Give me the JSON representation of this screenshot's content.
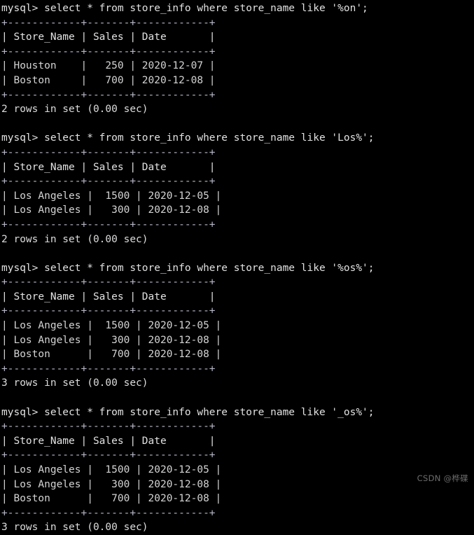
{
  "terminal": {
    "prompt": "mysql> ",
    "colors": {
      "background": "#000000",
      "text": "#d8d8d8",
      "rule": "#b8b8c8",
      "watermark": "#6d6d6d"
    },
    "table_rule": "+------------+-------+------------+",
    "table_header": "| Store_Name | Sales | Date       |",
    "watermark": "CSDN @桦碟",
    "blocks": [
      {
        "command": "mysql> select * from store_info where store_name like '%on';",
        "rule_top": "+------------+-------+------------+",
        "header": "| Store_Name | Sales | Date       |",
        "rule_mid": "+------------+-------+------------+",
        "rows": [
          "| Houston    |   250 | 2020-12-07 |",
          "| Boston     |   700 | 2020-12-08 |"
        ],
        "rule_bottom": "+------------+-------+------------+",
        "status": "2 rows in set (0.00 sec)",
        "query": {
          "statement": "select * from store_info where store_name like '%on';",
          "table": "store_info",
          "column": "store_name",
          "operator": "like",
          "pattern": "%on"
        },
        "result": {
          "columns": [
            "Store_Name",
            "Sales",
            "Date"
          ],
          "data": [
            [
              "Houston",
              "250",
              "2020-12-07"
            ],
            [
              "Boston",
              "700",
              "2020-12-08"
            ]
          ],
          "row_count": 2,
          "duration": "0.00 sec"
        }
      },
      {
        "command": "mysql> select * from store_info where store_name like 'Los%';",
        "rule_top": "+------------+-------+------------+",
        "header": "| Store_Name | Sales | Date       |",
        "rule_mid": "+------------+-------+------------+",
        "rows": [
          "| Los Angeles |  1500 | 2020-12-05 |",
          "| Los Angeles |   300 | 2020-12-08 |"
        ],
        "rule_bottom": "+------------+-------+------------+",
        "status": "2 rows in set (0.00 sec)",
        "query": {
          "statement": "select * from store_info where store_name like 'Los%';",
          "table": "store_info",
          "column": "store_name",
          "operator": "like",
          "pattern": "Los%"
        },
        "result": {
          "columns": [
            "Store_Name",
            "Sales",
            "Date"
          ],
          "data": [
            [
              "Los Angeles",
              "1500",
              "2020-12-05"
            ],
            [
              "Los Angeles",
              "300",
              "2020-12-08"
            ]
          ],
          "row_count": 2,
          "duration": "0.00 sec"
        }
      },
      {
        "command": "mysql> select * from store_info where store_name like '%os%';",
        "rule_top": "+------------+-------+------------+",
        "header": "| Store_Name | Sales | Date       |",
        "rule_mid": "+------------+-------+------------+",
        "rows": [
          "| Los Angeles |  1500 | 2020-12-05 |",
          "| Los Angeles |   300 | 2020-12-08 |",
          "| Boston      |   700 | 2020-12-08 |"
        ],
        "rule_bottom": "+------------+-------+------------+",
        "status": "3 rows in set (0.00 sec)",
        "query": {
          "statement": "select * from store_info where store_name like '%os%';",
          "table": "store_info",
          "column": "store_name",
          "operator": "like",
          "pattern": "%os%"
        },
        "result": {
          "columns": [
            "Store_Name",
            "Sales",
            "Date"
          ],
          "data": [
            [
              "Los Angeles",
              "1500",
              "2020-12-05"
            ],
            [
              "Los Angeles",
              "300",
              "2020-12-08"
            ],
            [
              "Boston",
              "700",
              "2020-12-08"
            ]
          ],
          "row_count": 3,
          "duration": "0.00 sec"
        }
      },
      {
        "command": "mysql> select * from store_info where store_name like '_os%';",
        "rule_top": "+------------+-------+------------+",
        "header": "| Store_Name | Sales | Date       |",
        "rule_mid": "+------------+-------+------------+",
        "rows": [
          "| Los Angeles |  1500 | 2020-12-05 |",
          "| Los Angeles |   300 | 2020-12-08 |",
          "| Boston      |   700 | 2020-12-08 |"
        ],
        "rule_bottom": "+------------+-------+------------+",
        "status": "3 rows in set (0.00 sec)",
        "query": {
          "statement": "select * from store_info where store_name like '_os%';",
          "table": "store_info",
          "column": "store_name",
          "operator": "like",
          "pattern": "_os%"
        },
        "result": {
          "columns": [
            "Store_Name",
            "Sales",
            "Date"
          ],
          "data": [
            [
              "Los Angeles",
              "1500",
              "2020-12-05"
            ],
            [
              "Los Angeles",
              "300",
              "2020-12-08"
            ],
            [
              "Boston",
              "700",
              "2020-12-08"
            ]
          ],
          "row_count": 3,
          "duration": "0.00 sec"
        }
      }
    ]
  }
}
